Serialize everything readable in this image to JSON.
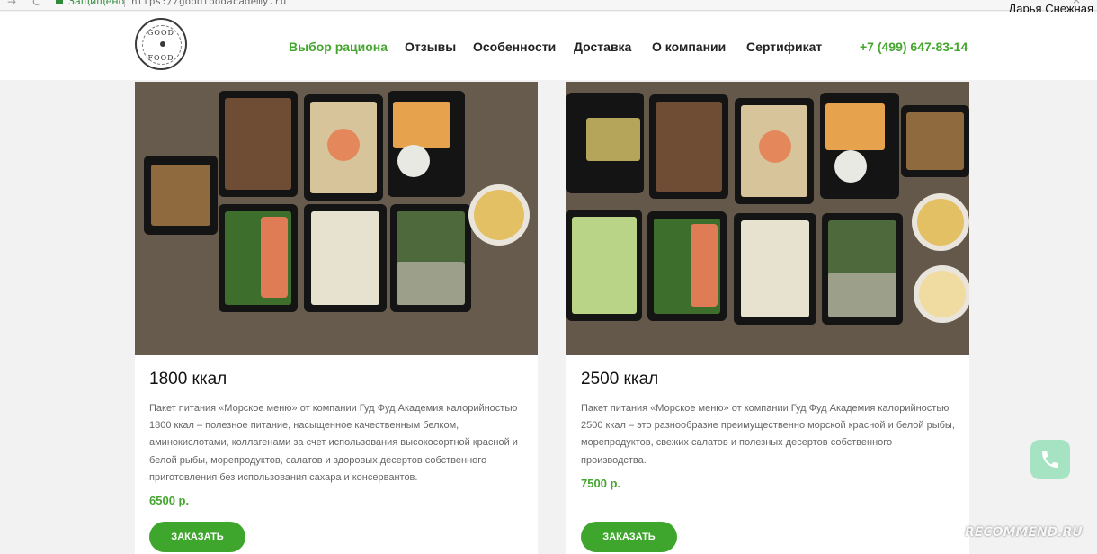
{
  "browser": {
    "secure_label": "Защищено",
    "url": "https://goodfoodacademy.ru"
  },
  "user": {
    "name": "Дарья Снежная"
  },
  "logo": {
    "text_top": "GOOD",
    "text_bottom": "FOOD"
  },
  "nav": [
    {
      "label": "Выбор рациона",
      "active": true
    },
    {
      "label": "Отзывы"
    },
    {
      "label": "Особенности"
    },
    {
      "label": "Доставка"
    },
    {
      "label": "О компании"
    },
    {
      "label": "Сертификат"
    }
  ],
  "phone": "+7 (499) 647-83-14",
  "cards": [
    {
      "title": "1800 ккал",
      "description": "Пакет питания «Морское меню» от компании Гуд Фуд Академия калорийностью 1800 ккал – полезное питание, насыщенное качественным белком, аминокислотами, коллагенами за счет использования высокосортной красной и белой рыбы, морепродуктов, салатов и здоровых десертов собственного приготовления без использования сахара и консервантов.",
      "price": "6500 р.",
      "button": "ЗАКАЗАТЬ"
    },
    {
      "title": "2500 ккал",
      "description": "Пакет питания «Морское меню» от компании Гуд Фуд Академия калорийностью 2500 ккал – это разнообразие преимущественно морской красной и белой рыбы, морепродуктов, свежих салатов и полезных десертов собственного производства.",
      "price": "7500 р.",
      "button": "ЗАКАЗАТЬ"
    }
  ],
  "watermark": "RECOMMEND.RU",
  "icons": {
    "lock": "lock-icon",
    "phone": "phone-icon",
    "back": "arrow-left-icon",
    "reload": "reload-icon"
  },
  "colors": {
    "accent": "#45a62f",
    "button": "#3fa62d",
    "call_button": "#a6e3c3",
    "background": "#f2f2f2"
  }
}
